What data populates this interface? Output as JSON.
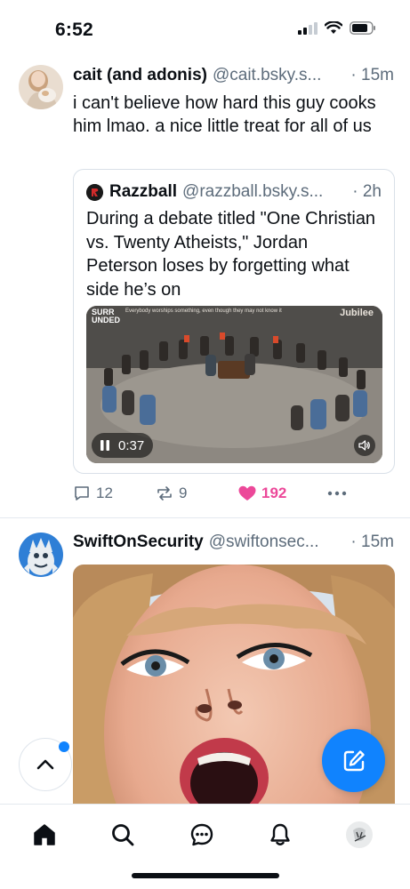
{
  "status_bar": {
    "time": "6:52",
    "icons": [
      "signal-icon",
      "wifi-icon",
      "battery-icon"
    ]
  },
  "feed": {
    "posts": [
      {
        "display_name": "cait (and adonis)",
        "handle": "@cait.bsky.s...",
        "time": "· 15m",
        "text": "i can't believe how hard this guy cooks him lmao. a nice little treat for all of us",
        "quote": {
          "display_name": "Razzball",
          "handle": "@razzball.bsky.s...",
          "time": "· 2h",
          "text": "During a debate titled \"One Christian vs. Twenty Atheists,\" Jordan Peterson loses by forgetting what side he’s on",
          "video": {
            "label_line1": "SURR",
            "label_line2": "UNDED",
            "caption": "Everybody worships something, even though they may not know it",
            "brand": "Jubilee",
            "duration": "0:37"
          }
        },
        "actions": {
          "replies": "12",
          "reposts": "9",
          "likes": "192"
        }
      },
      {
        "display_name": "SwiftOnSecurity",
        "handle": "@swiftonsec...",
        "time": "· 15m"
      }
    ]
  },
  "colors": {
    "accent": "#1083fe",
    "like": "#ec4899",
    "muted": "#5d6c7b"
  },
  "tab_bar": {
    "tabs": [
      "home-icon",
      "search-icon",
      "chat-icon",
      "bell-icon",
      "profile-avatar"
    ]
  }
}
